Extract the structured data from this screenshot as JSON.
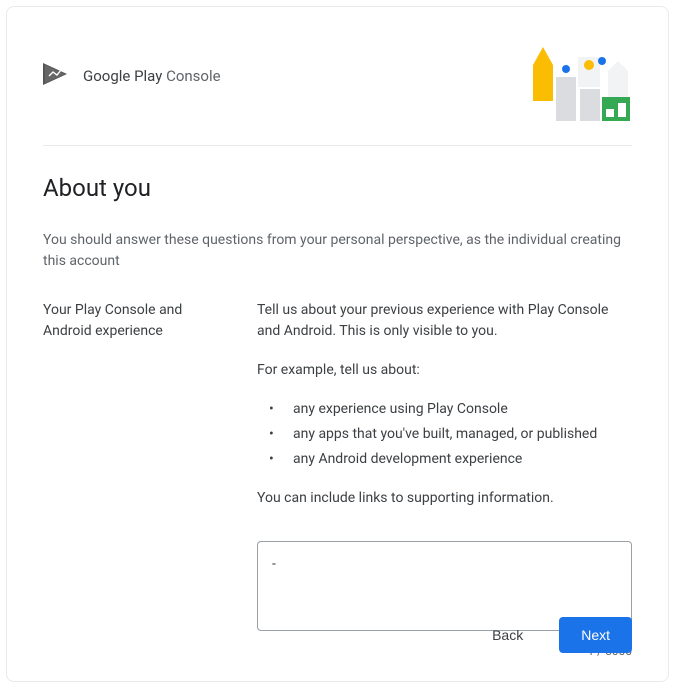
{
  "brand": {
    "name_dark": "Google Play",
    "name_light": "Console"
  },
  "page": {
    "title": "About you",
    "subtitle": "You should answer these questions from your personal perspective, as the individual creating this account"
  },
  "field": {
    "label": "Your Play Console and Android experience",
    "intro": "Tell us about your previous experience with Play Console and Android. This is only visible to you.",
    "example_lead": "For example, tell us about:",
    "bullets": [
      "any experience using Play Console",
      "any apps that you've built, managed, or published",
      "any Android development experience"
    ],
    "closing": "You can include links to supporting information.",
    "textarea_value": "-",
    "counter": "1 / 5000"
  },
  "buttons": {
    "back": "Back",
    "next": "Next"
  }
}
